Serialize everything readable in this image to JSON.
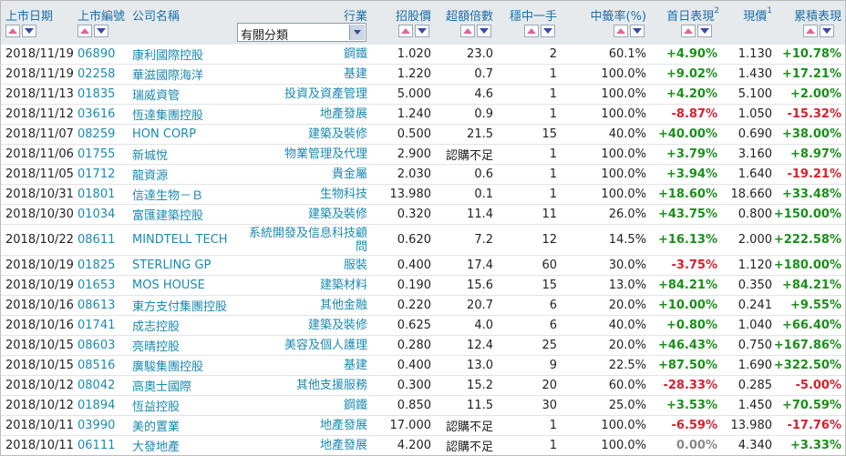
{
  "headers": {
    "list_date": "上市日期",
    "code": "上市編號",
    "name": "公司名稱",
    "industry": "行業",
    "ipo_price": "招股價",
    "oversub": "超額倍數",
    "one_lot": "穩中一手",
    "lottery_rate": "中籤率(%)",
    "first_day": "首日表現",
    "first_day_note": "2",
    "current": "現價",
    "current_note": "1",
    "cumulative": "累積表現"
  },
  "filter": {
    "selected": "有關分類"
  },
  "rows": [
    {
      "date": "2018/11/19",
      "code": "06890",
      "name": "康利國際控股",
      "industry": "鋼鐵",
      "price": "1.020",
      "oversub": "23.0",
      "lot": "2",
      "rate": "60.1%",
      "first": "+4.90%",
      "first_s": "pos",
      "cur": "1.130",
      "cum": "+10.78%",
      "cum_s": "pos"
    },
    {
      "date": "2018/11/19",
      "code": "02258",
      "name": "華滋國際海洋",
      "industry": "基建",
      "price": "1.220",
      "oversub": "0.7",
      "lot": "1",
      "rate": "100.0%",
      "first": "+9.02%",
      "first_s": "pos",
      "cur": "1.430",
      "cum": "+17.21%",
      "cum_s": "pos"
    },
    {
      "date": "2018/11/13",
      "code": "01835",
      "name": "瑞威資管",
      "industry": "投資及資產管理",
      "price": "5.000",
      "oversub": "4.6",
      "lot": "1",
      "rate": "100.0%",
      "first": "+4.20%",
      "first_s": "pos",
      "cur": "5.100",
      "cum": "+2.00%",
      "cum_s": "pos"
    },
    {
      "date": "2018/11/12",
      "code": "03616",
      "name": "恆達集團控股",
      "industry": "地產發展",
      "price": "1.240",
      "oversub": "0.9",
      "lot": "1",
      "rate": "100.0%",
      "first": "-8.87%",
      "first_s": "neg",
      "cur": "1.050",
      "cum": "-15.32%",
      "cum_s": "neg"
    },
    {
      "date": "2018/11/07",
      "code": "08259",
      "name": "HON CORP",
      "industry": "建築及裝修",
      "price": "0.500",
      "oversub": "21.5",
      "lot": "15",
      "rate": "40.0%",
      "first": "+40.00%",
      "first_s": "pos",
      "cur": "0.690",
      "cum": "+38.00%",
      "cum_s": "pos"
    },
    {
      "date": "2018/11/06",
      "code": "01755",
      "name": "新城悅",
      "industry": "物業管理及代理",
      "price": "2.900",
      "oversub": "認購不足",
      "lot": "1",
      "rate": "100.0%",
      "first": "+3.79%",
      "first_s": "pos",
      "cur": "3.160",
      "cum": "+8.97%",
      "cum_s": "pos"
    },
    {
      "date": "2018/11/05",
      "code": "01712",
      "name": "龍資源",
      "industry": "貴金屬",
      "price": "2.030",
      "oversub": "0.6",
      "lot": "1",
      "rate": "100.0%",
      "first": "+3.94%",
      "first_s": "pos",
      "cur": "1.640",
      "cum": "-19.21%",
      "cum_s": "neg"
    },
    {
      "date": "2018/10/31",
      "code": "01801",
      "name": "信達生物－Ｂ",
      "industry": "生物科技",
      "price": "13.980",
      "oversub": "0.1",
      "lot": "1",
      "rate": "100.0%",
      "first": "+18.60%",
      "first_s": "pos",
      "cur": "18.660",
      "cum": "+33.48%",
      "cum_s": "pos"
    },
    {
      "date": "2018/10/30",
      "code": "01034",
      "name": "富匯建築控股",
      "industry": "建築及裝修",
      "price": "0.320",
      "oversub": "11.4",
      "lot": "11",
      "rate": "26.0%",
      "first": "+43.75%",
      "first_s": "pos",
      "cur": "0.800",
      "cum": "+150.00%",
      "cum_s": "pos"
    },
    {
      "date": "2018/10/22",
      "code": "08611",
      "name": "MINDTELL TECH",
      "industry": "系統開發及信息科技顧問",
      "price": "0.620",
      "oversub": "7.2",
      "lot": "12",
      "rate": "14.5%",
      "first": "+16.13%",
      "first_s": "pos",
      "cur": "2.000",
      "cum": "+222.58%",
      "cum_s": "pos",
      "tall": true
    },
    {
      "date": "2018/10/19",
      "code": "01825",
      "name": "STERLING GP",
      "industry": "服裝",
      "price": "0.400",
      "oversub": "17.4",
      "lot": "60",
      "rate": "30.0%",
      "first": "-3.75%",
      "first_s": "neg",
      "cur": "1.120",
      "cum": "+180.00%",
      "cum_s": "pos"
    },
    {
      "date": "2018/10/19",
      "code": "01653",
      "name": "MOS HOUSE",
      "industry": "建築材料",
      "price": "0.190",
      "oversub": "15.6",
      "lot": "15",
      "rate": "13.0%",
      "first": "+84.21%",
      "first_s": "pos",
      "cur": "0.350",
      "cum": "+84.21%",
      "cum_s": "pos"
    },
    {
      "date": "2018/10/16",
      "code": "08613",
      "name": "東方支付集團控股",
      "industry": "其他金融",
      "price": "0.220",
      "oversub": "20.7",
      "lot": "6",
      "rate": "20.0%",
      "first": "+10.00%",
      "first_s": "pos",
      "cur": "0.241",
      "cum": "+9.55%",
      "cum_s": "pos"
    },
    {
      "date": "2018/10/16",
      "code": "01741",
      "name": "成志控股",
      "industry": "建築及裝修",
      "price": "0.625",
      "oversub": "4.0",
      "lot": "6",
      "rate": "40.0%",
      "first": "+0.80%",
      "first_s": "pos",
      "cur": "1.040",
      "cum": "+66.40%",
      "cum_s": "pos"
    },
    {
      "date": "2018/10/15",
      "code": "08603",
      "name": "亮晴控股",
      "industry": "美容及個人護理",
      "price": "0.280",
      "oversub": "12.4",
      "lot": "25",
      "rate": "20.0%",
      "first": "+46.43%",
      "first_s": "pos",
      "cur": "0.750",
      "cum": "+167.86%",
      "cum_s": "pos"
    },
    {
      "date": "2018/10/15",
      "code": "08516",
      "name": "廣駿集團控股",
      "industry": "基建",
      "price": "0.400",
      "oversub": "13.0",
      "lot": "9",
      "rate": "22.5%",
      "first": "+87.50%",
      "first_s": "pos",
      "cur": "1.690",
      "cum": "+322.50%",
      "cum_s": "pos"
    },
    {
      "date": "2018/10/12",
      "code": "08042",
      "name": "高奧士國際",
      "industry": "其他支援服務",
      "price": "0.300",
      "oversub": "15.2",
      "lot": "20",
      "rate": "60.0%",
      "first": "-28.33%",
      "first_s": "neg",
      "cur": "0.285",
      "cum": "-5.00%",
      "cum_s": "neg"
    },
    {
      "date": "2018/10/12",
      "code": "01894",
      "name": "恆益控股",
      "industry": "鋼鐵",
      "price": "0.850",
      "oversub": "11.5",
      "lot": "30",
      "rate": "25.0%",
      "first": "+3.53%",
      "first_s": "pos",
      "cur": "1.450",
      "cum": "+70.59%",
      "cum_s": "pos"
    },
    {
      "date": "2018/10/11",
      "code": "03990",
      "name": "美的置業",
      "industry": "地產發展",
      "price": "17.000",
      "oversub": "認購不足",
      "lot": "1",
      "rate": "100.0%",
      "first": "-6.59%",
      "first_s": "neg",
      "cur": "13.980",
      "cum": "-17.76%",
      "cum_s": "neg"
    },
    {
      "date": "2018/10/11",
      "code": "06111",
      "name": "大發地產",
      "industry": "地產發展",
      "price": "4.200",
      "oversub": "認購不足",
      "lot": "1",
      "rate": "100.0%",
      "first": "0.00%",
      "first_s": "zero",
      "cur": "4.340",
      "cum": "+3.33%",
      "cum_s": "pos"
    }
  ]
}
